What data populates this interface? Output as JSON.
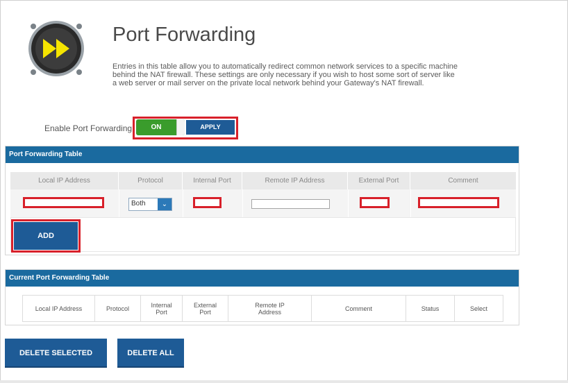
{
  "header": {
    "title": "Port Forwarding",
    "description": "Entries in this table allow you to automatically redirect common network services to a specific machine behind the NAT firewall. These settings are only necessary if you wish to host some sort of server like a web server or mail server on the private local network behind your Gateway's NAT firewall.",
    "logo_icon": "fast-forward-icon"
  },
  "enable": {
    "label": "Enable Port Forwarding",
    "toggle_state": "ON",
    "apply_label": "APPLY"
  },
  "pf_table": {
    "title": "Port Forwarding Table",
    "columns": [
      "Local IP Address",
      "Protocol",
      "Internal Port",
      "Remote IP Address",
      "External Port",
      "Comment"
    ],
    "protocol_value": "Both",
    "local_ip_value": "",
    "internal_port_value": "",
    "remote_ip_value": "",
    "external_port_value": "",
    "comment_value": "",
    "add_label": "ADD"
  },
  "current_table": {
    "title": "Current Port Forwarding Table",
    "columns": [
      "Local IP Address",
      "Protocol",
      "Internal\nPort",
      "External\nPort",
      "Remote IP\nAddress",
      "Comment",
      "Status",
      "Select"
    ]
  },
  "actions": {
    "delete_selected": "DELETE SELECTED",
    "delete_all": "DELETE ALL"
  },
  "colors": {
    "accent": "#1e5b96",
    "header_bar": "#1a6a9f",
    "highlight": "#d8202a",
    "toggle_on": "#3a9c2c"
  }
}
